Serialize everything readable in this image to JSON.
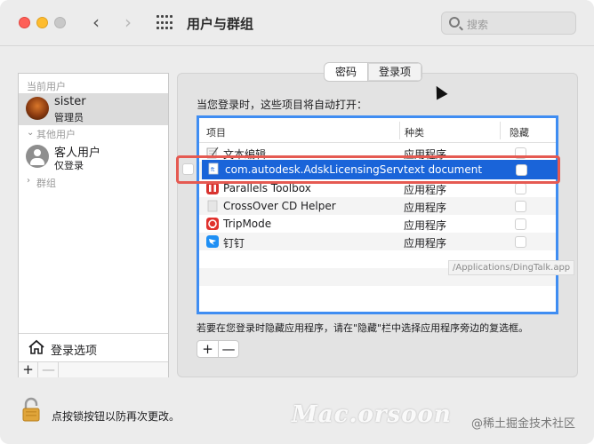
{
  "window": {
    "title": "用户与群组",
    "search_placeholder": "搜索"
  },
  "sidebar": {
    "current_users_label": "当前用户",
    "other_users_label": "其他用户",
    "groups_label": "群组",
    "users": [
      {
        "name": "sister",
        "role": "管理员"
      },
      {
        "name": "客人用户",
        "role": "仅登录"
      }
    ],
    "login_options": "登录选项",
    "add": "+",
    "remove": "—"
  },
  "tabs": [
    "密码",
    "登录项"
  ],
  "instruction": "当您登录时，这些项目将自动打开：",
  "table": {
    "headers": [
      "项目",
      "种类",
      "隐藏"
    ],
    "rows": [
      {
        "name": "文本编辑",
        "kind": "应用程序",
        "icon": "textedit-icon"
      },
      {
        "name": "com.autodesk.AdskLicensingServi",
        "kind": "text document",
        "icon": "document-icon",
        "selected": true
      },
      {
        "name": "Parallels Toolbox",
        "kind": "应用程序",
        "icon": "parallels-icon"
      },
      {
        "name": "CrossOver CD Helper",
        "kind": "应用程序",
        "icon": "crossover-icon"
      },
      {
        "name": "TripMode",
        "kind": "应用程序",
        "icon": "tripmode-icon"
      },
      {
        "name": "钉钉",
        "kind": "应用程序",
        "icon": "dingtalk-icon"
      }
    ]
  },
  "tooltip": "/Applications/DingTalk.app",
  "hint": "若要在您登录时隐藏应用程序，请在\"隐藏\"栏中选择应用程序旁边的复选框。",
  "pm": {
    "add": "+",
    "remove": "—"
  },
  "lock_text": "点按锁按钮以防再次更改。",
  "watermark": "Mac.orsoon",
  "watermark_sub": "@稀土掘金技术社区",
  "colors": {
    "accent": "#1a64d9",
    "highlight_border": "#e55a52",
    "table_border": "#3f8df2"
  }
}
